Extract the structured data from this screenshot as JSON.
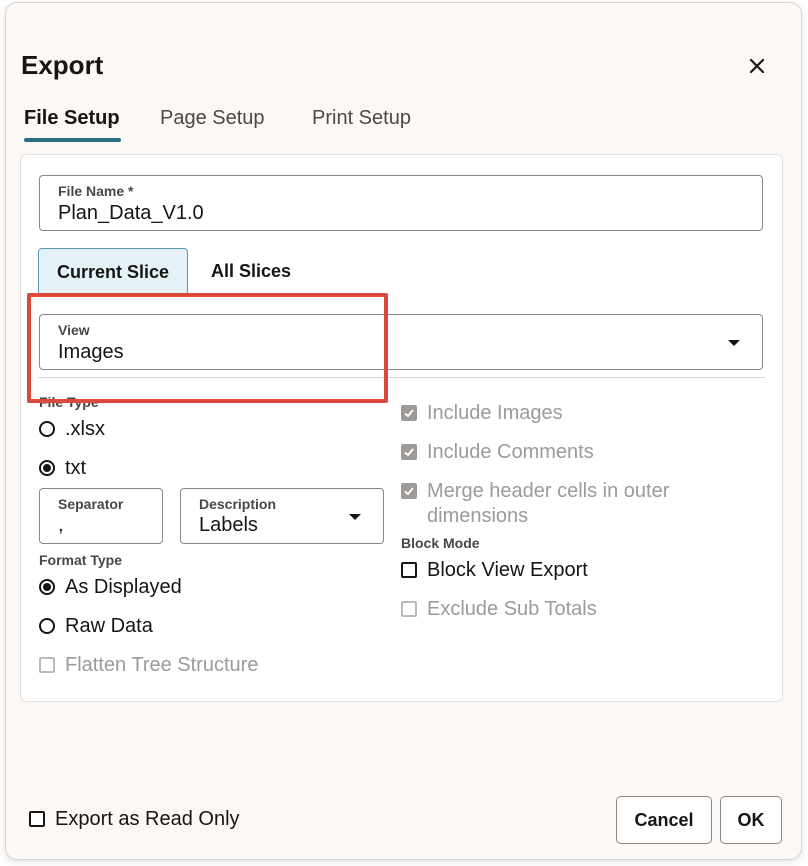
{
  "dialog": {
    "title": "Export",
    "tabs": [
      {
        "label": "File Setup",
        "active": true
      },
      {
        "label": "Page Setup",
        "active": false
      },
      {
        "label": "Print Setup",
        "active": false
      }
    ],
    "file_name": {
      "label": "File Name *",
      "value": "Plan_Data_V1.0"
    },
    "slice": {
      "current": "Current Slice",
      "all": "All Slices"
    },
    "view": {
      "label": "View",
      "value": "Images"
    },
    "file_type": {
      "label": "File Type",
      "xlsx": ".xlsx",
      "txt": "txt",
      "selected": "txt",
      "separator": {
        "label": "Separator",
        "value": ","
      },
      "description": {
        "label": "Description",
        "value": "Labels"
      }
    },
    "right_options": {
      "include_images": "Include Images",
      "include_comments": "Include Comments",
      "merge_header_line1": "Merge header cells in outer",
      "merge_header_line2": "dimensions"
    },
    "format_type": {
      "label": "Format Type",
      "as_displayed": "As Displayed",
      "raw_data": "Raw Data",
      "flatten_tree": "Flatten Tree Structure"
    },
    "block_mode": {
      "label": "Block Mode",
      "block_view_export": "Block View Export",
      "exclude_sub_totals": "Exclude Sub Totals"
    },
    "footer": {
      "export_read_only": "Export as Read Only",
      "cancel": "Cancel",
      "ok": "OK"
    },
    "colors": {
      "accent": "#2b6b84",
      "highlight": "#d94a3d",
      "selected_bg": "#e4f1f7"
    }
  }
}
